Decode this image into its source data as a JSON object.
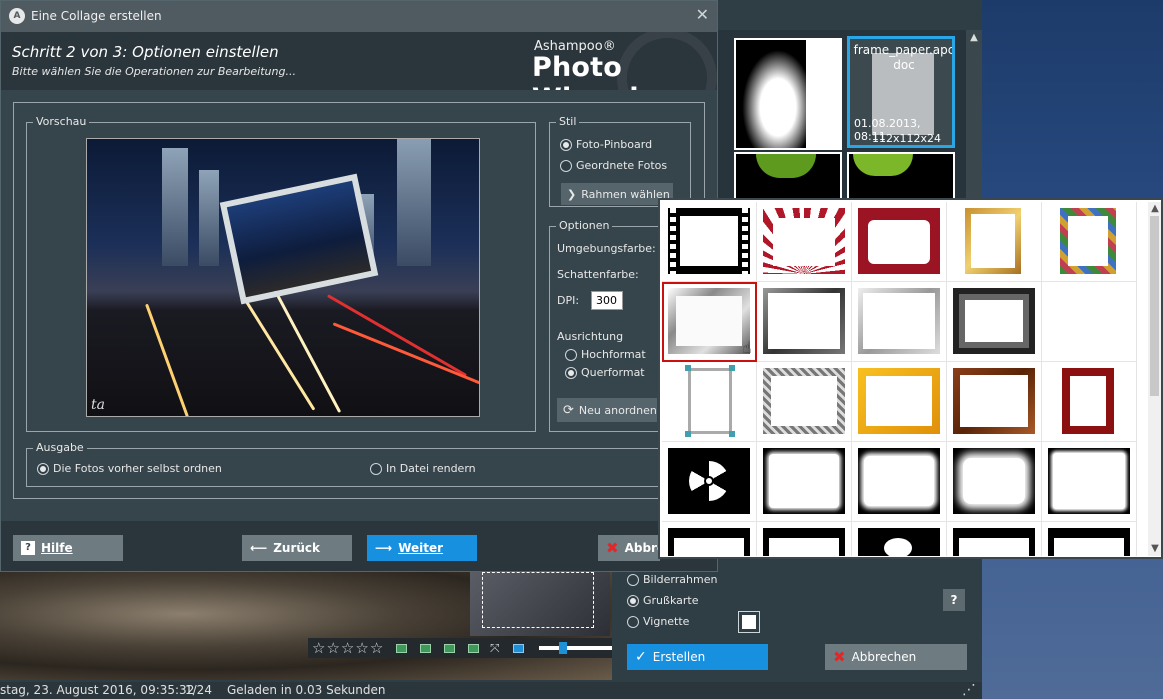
{
  "wizard": {
    "window_title": "Eine Collage erstellen",
    "step_title": "Schritt 2 von 3: Optionen einstellen",
    "step_subtitle": "Bitte wählen Sie die Operationen zur Bearbeitung...",
    "brand_small": "Ashampoo®",
    "brand_big": "Photo Wizard",
    "preview_label": "Vorschau",
    "stil": {
      "label": "Stil",
      "options": [
        {
          "label": "Foto-Pinboard",
          "selected": true
        },
        {
          "label": "Geordnete Fotos",
          "selected": false
        }
      ],
      "frame_button": "Rahmen wählen"
    },
    "optionen": {
      "label": "Optionen",
      "umgebungsfarbe": "Umgebungsfarbe:",
      "schattenfarbe": "Schattenfarbe:",
      "dpi_label": "DPI:",
      "dpi_value": "300",
      "ausrichtung_label": "Ausrichtung",
      "ausrichtung": [
        {
          "label": "Hochformat",
          "selected": false
        },
        {
          "label": "Querformat",
          "selected": true
        }
      ],
      "rearrange_button": "Neu anordnen"
    },
    "ausgabe": {
      "label": "Ausgabe",
      "options": [
        {
          "label": "Die Fotos vorher selbst ordnen",
          "selected": true
        },
        {
          "label": "In Datei rendern",
          "selected": false
        }
      ]
    },
    "buttons": {
      "help": "Hilfe",
      "back": "Zurück",
      "next": "Weiter",
      "cancel": "Abbre"
    }
  },
  "thumbnail": {
    "name": "frame_paper.apcdoc",
    "date": "01.08.2013, 08:11",
    "size": "112x112x24"
  },
  "frame_options": {
    "options": [
      {
        "label": "Bilderrahmen",
        "selected": false
      },
      {
        "label": "Grußkarte",
        "selected": true
      },
      {
        "label": "Vignette",
        "selected": false
      }
    ],
    "help_icon": "?",
    "create_button": "Erstellen",
    "cancel_button": "Abbrechen"
  },
  "status_bar": {
    "date": "stag, 23. August 2016, 09:35:32",
    "page": "1/24",
    "loaded": "Geladen in 0.03 Sekunden"
  },
  "preview_signature": "ta",
  "colors": {
    "accent_blue": "#1890e0",
    "selection_red": "#cc1010",
    "dialog_bg": "#36454c"
  }
}
